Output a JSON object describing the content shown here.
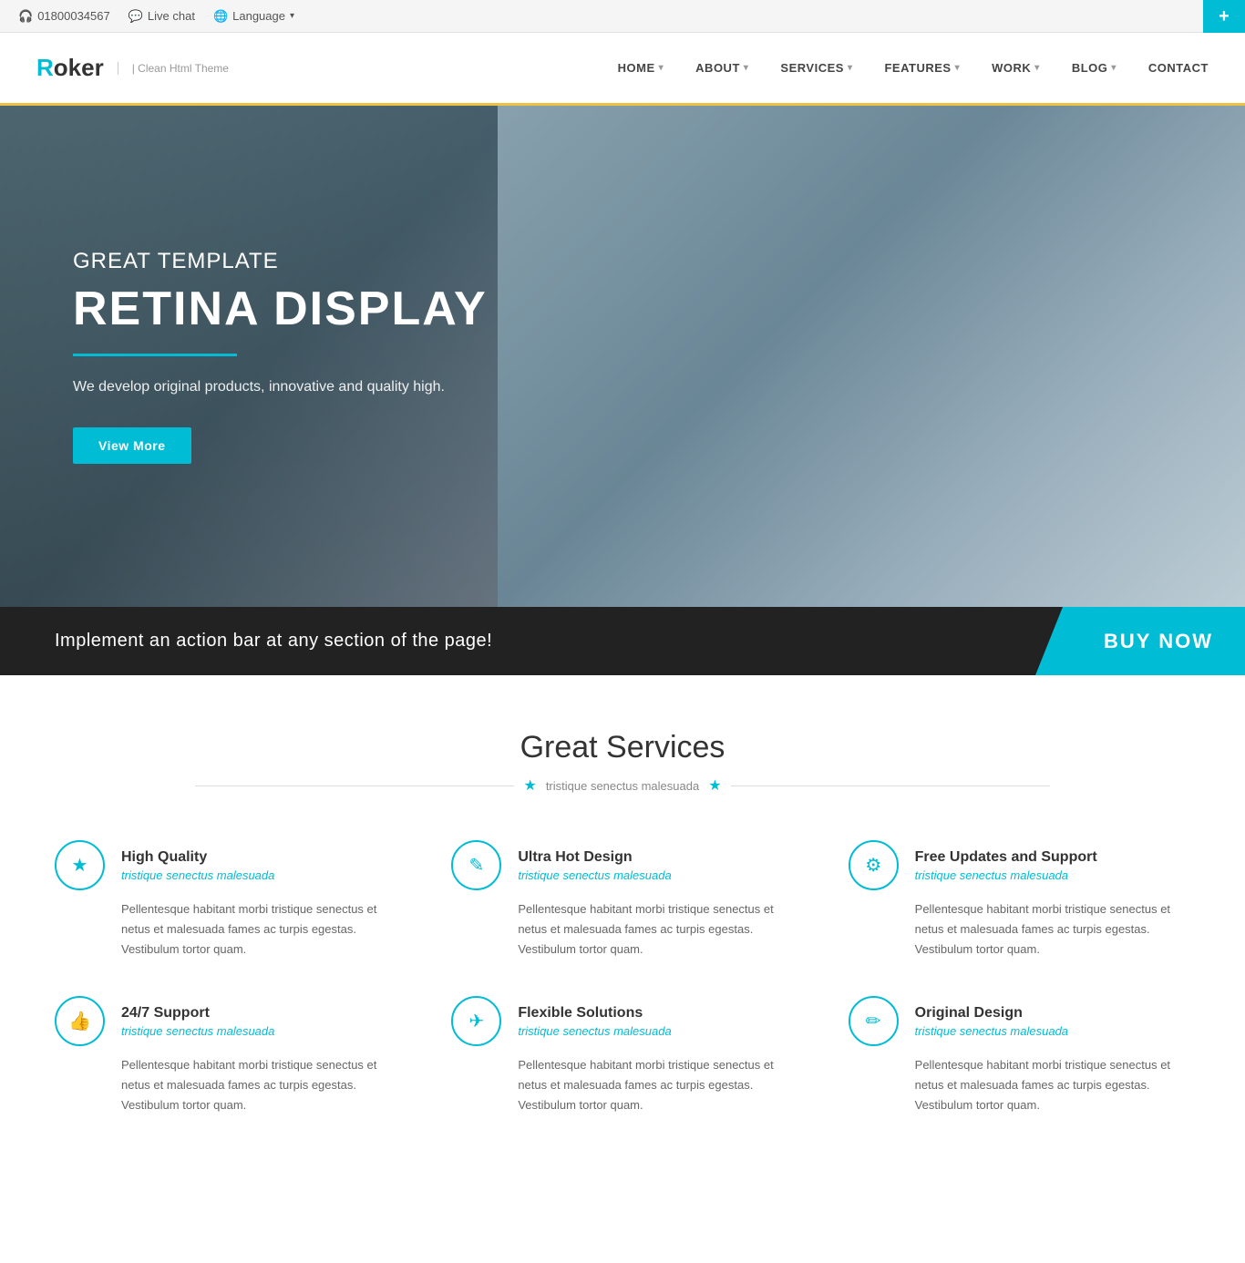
{
  "topbar": {
    "phone": "01800034567",
    "live_chat": "Live chat",
    "language": "Language",
    "plus_icon": "+"
  },
  "navbar": {
    "logo_letter": "R",
    "logo_rest": "oker",
    "tagline": "| Clean Html Theme",
    "nav_items": [
      {
        "label": "HOME",
        "has_arrow": true
      },
      {
        "label": "ABOUT",
        "has_arrow": true
      },
      {
        "label": "SERVICES",
        "has_arrow": true
      },
      {
        "label": "FEATURES",
        "has_arrow": true
      },
      {
        "label": "WORK",
        "has_arrow": true
      },
      {
        "label": "BLOG",
        "has_arrow": true
      },
      {
        "label": "CONTACT",
        "has_arrow": false
      }
    ]
  },
  "hero": {
    "subtitle": "GREAT TEMPLATE",
    "title": "RETINA DISPLAY",
    "description": "We develop original products, innovative and quality high.",
    "button_label": "View More"
  },
  "action_bar": {
    "text": "Implement an action bar at any section of the page!",
    "button_label": "BUY NOW"
  },
  "services": {
    "title": "Great Services",
    "subtitle": "tristique senectus malesuada",
    "items": [
      {
        "icon": "★",
        "title": "High Quality",
        "sub": "tristique senectus malesuada",
        "desc": "Pellentesque habitant morbi tristique senectus et netus et malesuada fames ac turpis egestas. Vestibulum tortor quam."
      },
      {
        "icon": "✎",
        "title": "Ultra Hot Design",
        "sub": "tristique senectus malesuada",
        "desc": "Pellentesque habitant morbi tristique senectus et netus et malesuada fames ac turpis egestas. Vestibulum tortor quam."
      },
      {
        "icon": "⚙",
        "title": "Free Updates and Support",
        "sub": "tristique senectus malesuada",
        "desc": "Pellentesque habitant morbi tristique senectus et netus et malesuada fames ac turpis egestas. Vestibulum tortor quam."
      },
      {
        "icon": "👍",
        "title": "24/7 Support",
        "sub": "tristique senectus malesuada",
        "desc": "Pellentesque habitant morbi tristique senectus et netus et malesuada fames ac turpis egestas. Vestibulum tortor quam."
      },
      {
        "icon": "✈",
        "title": "Flexible Solutions",
        "sub": "tristique senectus malesuada",
        "desc": "Pellentesque habitant morbi tristique senectus et netus et malesuada fames ac turpis egestas. Vestibulum tortor quam."
      },
      {
        "icon": "✏",
        "title": "Original Design",
        "sub": "tristique senectus malesuada",
        "desc": "Pellentesque habitant morbi tristique senectus et netus et malesuada fames ac turpis egestas. Vestibulum tortor quam."
      }
    ]
  }
}
